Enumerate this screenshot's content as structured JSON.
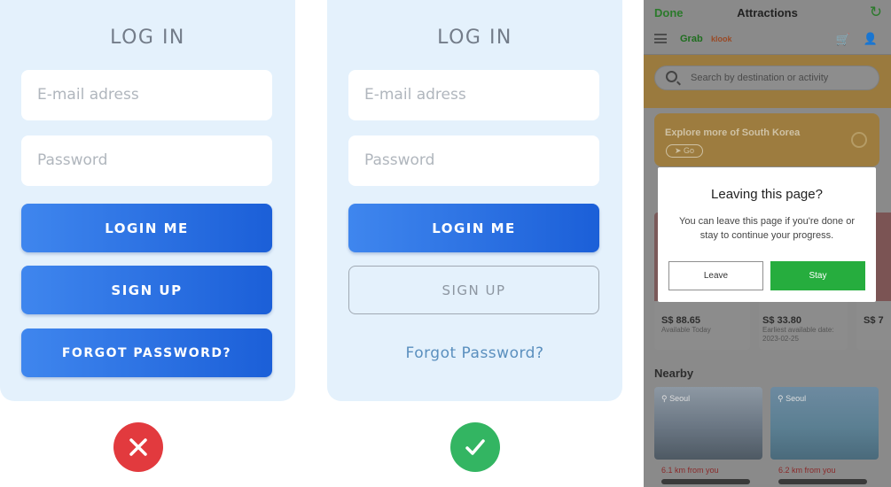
{
  "bad_example": {
    "title": "LOG IN",
    "email_placeholder": "E-mail adress",
    "password_placeholder": "Password",
    "login_label": "LOGIN ME",
    "signup_label": "SIGN UP",
    "forgot_label": "FORGOT PASSWORD?",
    "verdict_icon": "cross-icon",
    "verdict_color": "#e23a3e"
  },
  "good_example": {
    "title": "LOG IN",
    "email_placeholder": "E-mail adress",
    "password_placeholder": "Password",
    "login_label": "LOGIN ME",
    "signup_label": "SIGN UP",
    "forgot_label": "Forgot Password?",
    "verdict_icon": "check-icon",
    "verdict_color": "#33b562"
  },
  "colors": {
    "card_bg": "#e4f1fc",
    "primary_button": "#2d72e3",
    "link": "#5a8fbe"
  },
  "phone": {
    "top_bar": {
      "done_label": "Done",
      "title": "Attractions",
      "refresh_icon": "refresh-icon"
    },
    "nav": {
      "menu_icon": "menu-icon",
      "grab_label": "Grab",
      "klook_label": "klook",
      "cart_icon": "cart-icon",
      "user_icon": "user-icon"
    },
    "search_placeholder": "Search by destination or activity",
    "explore_banner": {
      "text": "Explore more of South Korea",
      "go_label": "Go"
    },
    "products": [
      {
        "price": "S$ 88.65",
        "sub": "Available Today"
      },
      {
        "price": "S$ 33.80",
        "sub": "Earliest available date: 2023-02-25"
      },
      {
        "price": "S$ 7",
        "sub": ""
      }
    ],
    "nearby": {
      "heading": "Nearby",
      "items": [
        {
          "location": "Seoul",
          "distance": "6.1 km from you"
        },
        {
          "location": "Seoul",
          "distance": "6.2 km from you"
        }
      ]
    },
    "dialog": {
      "title": "Leaving this page?",
      "message": "You can leave this page if you're done or stay to continue your progress.",
      "leave_label": "Leave",
      "stay_label": "Stay",
      "stay_color": "#26ad3e"
    }
  }
}
